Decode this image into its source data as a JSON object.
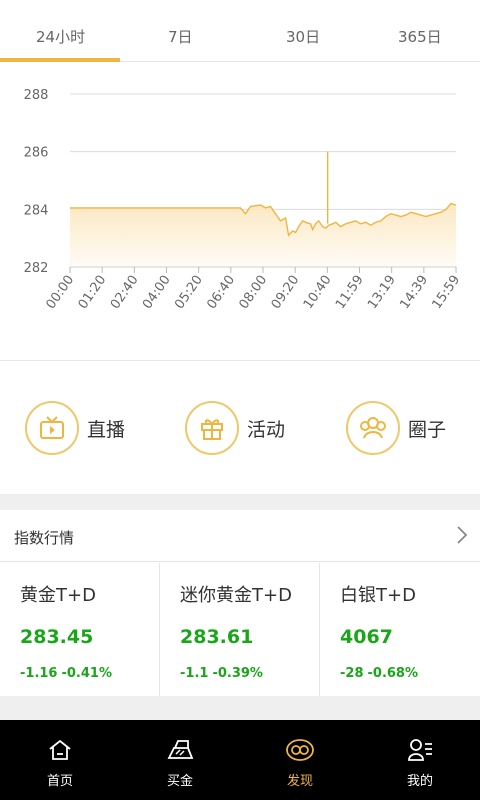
{
  "tabs": [
    {
      "label": "24小时",
      "active": true
    },
    {
      "label": "7日"
    },
    {
      "label": "30日"
    },
    {
      "label": "365日"
    }
  ],
  "chart_data": {
    "type": "area",
    "yticks": [
      "288",
      "286",
      "284",
      "282"
    ],
    "ylim": [
      282,
      288
    ],
    "xticks": [
      "00:00",
      "01:20",
      "02:40",
      "04:00",
      "05:20",
      "06:40",
      "08:00",
      "09:20",
      "10:40",
      "11:59",
      "13:19",
      "14:39",
      "15:59"
    ],
    "grid": true,
    "color": "#f0b541",
    "fill": "#fbe7bf",
    "series": [
      {
        "x": [
          0,
          40,
          80,
          120,
          160,
          166,
          170,
          175,
          180,
          190,
          195,
          200,
          203,
          206,
          210,
          215,
          218,
          222,
          225,
          228,
          232,
          235,
          240,
          242,
          245,
          248,
          252,
          255,
          258,
          262,
          265,
          270,
          275,
          280,
          285,
          290,
          295,
          300,
          305,
          310,
          315,
          320,
          325,
          330,
          335,
          340,
          345,
          350,
          355,
          360,
          365,
          370,
          375,
          380,
          385
        ],
        "y": [
          284.05,
          284.05,
          284.05,
          284.05,
          284.05,
          284.05,
          284.05,
          283.85,
          284.1,
          284.15,
          284.05,
          284.1,
          283.95,
          283.8,
          283.6,
          283.7,
          283.1,
          283.25,
          283.2,
          283.4,
          283.6,
          283.55,
          283.5,
          283.3,
          283.5,
          283.6,
          283.4,
          283.35,
          283.45,
          283.5,
          283.55,
          283.4,
          283.5,
          283.55,
          283.6,
          283.5,
          283.55,
          283.45,
          283.55,
          283.6,
          283.75,
          283.85,
          283.8,
          283.75,
          283.8,
          283.9,
          283.85,
          283.8,
          283.75,
          283.8,
          283.85,
          283.9,
          284.0,
          284.2,
          284.15
        ],
        "spike": {
          "x": 257,
          "y": 286.0
        }
      }
    ]
  },
  "shortcuts": [
    {
      "label": "直播",
      "icon": "tv-icon"
    },
    {
      "label": "活动",
      "icon": "gift-icon"
    },
    {
      "label": "圈子",
      "icon": "group-icon"
    }
  ],
  "index": {
    "title": "指数行情",
    "cards": [
      {
        "name": "黄金T+D",
        "price": "283.45",
        "change": "-1.16",
        "pct": "-0.41%"
      },
      {
        "name": "迷你黄金T+D",
        "price": "283.61",
        "change": "-1.1",
        "pct": "-0.39%"
      },
      {
        "name": "白银T+D",
        "price": "4067",
        "change": "-28",
        "pct": "-0.68%"
      }
    ]
  },
  "nav": [
    {
      "label": "首页",
      "icon": "home-icon"
    },
    {
      "label": "买金",
      "icon": "gold-bar-icon"
    },
    {
      "label": "发现",
      "icon": "discover-icon",
      "active": true
    },
    {
      "label": "我的",
      "icon": "profile-icon"
    }
  ],
  "colors": {
    "accent": "#f0b541",
    "positive_negative_green": "#1aa51a"
  }
}
